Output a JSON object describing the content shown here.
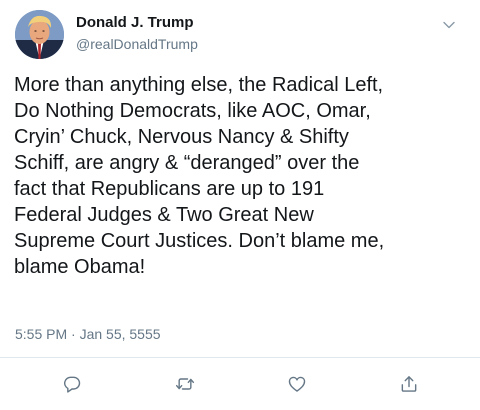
{
  "tweet": {
    "author": {
      "display_name": "Donald J. Trump",
      "handle": "@realDonaldTrump",
      "avatar_icon": "profile-photo"
    },
    "menu_icon": "chevron-down-icon",
    "text": "More than anything else, the Radical Left,\nDo Nothing Democrats, like AOC, Omar,\nCryin’ Chuck, Nervous Nancy & Shifty\nSchiff, are angry & “deranged” over the\nfact that Republicans are up to 191\nFederal Judges & Two Great New\nSupreme Court Justices. Don’t blame me,\nblame Obama!",
    "timestamp": "5:55 PM · Jan 55, 5555",
    "actions": [
      {
        "icon": "reply-icon"
      },
      {
        "icon": "retweet-icon"
      },
      {
        "icon": "like-icon"
      },
      {
        "icon": "share-icon"
      }
    ]
  },
  "colors": {
    "text_primary": "#14171a",
    "text_secondary": "#657786",
    "icon_gray": "#657786",
    "divider": "#e1e8ed"
  }
}
